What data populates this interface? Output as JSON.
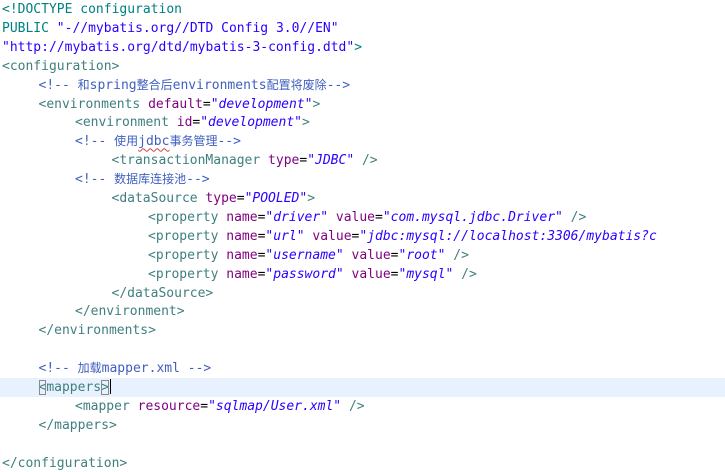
{
  "editor": {
    "lines": [
      {
        "indent": 0,
        "tokens": [
          {
            "t": "decl",
            "v": "<!DOCTYPE configuration"
          }
        ]
      },
      {
        "indent": 0,
        "tokens": [
          {
            "t": "decl",
            "v": "PUBLIC "
          },
          {
            "t": "value",
            "v": "\"-//mybatis.org//DTD Config 3.0//EN\""
          }
        ]
      },
      {
        "indent": 0,
        "tokens": [
          {
            "t": "value",
            "v": "\"http://mybatis.org/dtd/mybatis-3-config.dtd\""
          },
          {
            "t": "decl",
            "v": ">"
          }
        ]
      },
      {
        "indent": 0,
        "tokens": [
          {
            "t": "tag",
            "v": "<configuration>"
          }
        ]
      },
      {
        "indent": 1,
        "tokens": [
          {
            "t": "comment",
            "v": "<!-- "
          },
          {
            "t": "cjk",
            "v": "和"
          },
          {
            "t": "comment",
            "v": "spring"
          },
          {
            "t": "cjk",
            "v": "整合后"
          },
          {
            "t": "comment",
            "v": "environments"
          },
          {
            "t": "cjk",
            "v": "配置将废除"
          },
          {
            "t": "comment",
            "v": "-->"
          }
        ]
      },
      {
        "indent": 1,
        "tokens": [
          {
            "t": "tag",
            "v": "<environments "
          },
          {
            "t": "attr",
            "v": "default"
          },
          {
            "t": "plain",
            "v": "="
          },
          {
            "t": "ivalue",
            "v": "\"development\""
          },
          {
            "t": "tag",
            "v": ">"
          }
        ]
      },
      {
        "indent": 2,
        "tokens": [
          {
            "t": "tag",
            "v": "<environment "
          },
          {
            "t": "attr",
            "v": "id"
          },
          {
            "t": "plain",
            "v": "="
          },
          {
            "t": "ivalue",
            "v": "\"development\""
          },
          {
            "t": "tag",
            "v": ">"
          }
        ]
      },
      {
        "indent": 2,
        "tokens": [
          {
            "t": "comment",
            "v": "<!-- "
          },
          {
            "t": "cjk",
            "v": "使用"
          },
          {
            "t": "spell",
            "v": "jdbc"
          },
          {
            "t": "cjk",
            "v": "事务管理"
          },
          {
            "t": "comment",
            "v": "-->"
          }
        ]
      },
      {
        "indent": 3,
        "tokens": [
          {
            "t": "tag",
            "v": "<transactionManager "
          },
          {
            "t": "attr",
            "v": "type"
          },
          {
            "t": "plain",
            "v": "="
          },
          {
            "t": "ivalue",
            "v": "\"JDBC\""
          },
          {
            "t": "tag",
            "v": " />"
          }
        ]
      },
      {
        "indent": 2,
        "tokens": [
          {
            "t": "comment",
            "v": "<!-- "
          },
          {
            "t": "cjk",
            "v": "数据库连接池"
          },
          {
            "t": "comment",
            "v": "-->"
          }
        ]
      },
      {
        "indent": 3,
        "tokens": [
          {
            "t": "tag",
            "v": "<dataSource "
          },
          {
            "t": "attr",
            "v": "type"
          },
          {
            "t": "plain",
            "v": "="
          },
          {
            "t": "ivalue",
            "v": "\"POOLED\""
          },
          {
            "t": "tag",
            "v": ">"
          }
        ]
      },
      {
        "indent": 4,
        "tokens": [
          {
            "t": "tag",
            "v": "<property "
          },
          {
            "t": "attr",
            "v": "name"
          },
          {
            "t": "plain",
            "v": "="
          },
          {
            "t": "ivalue",
            "v": "\"driver\""
          },
          {
            "t": "plain",
            "v": " "
          },
          {
            "t": "attr",
            "v": "value"
          },
          {
            "t": "plain",
            "v": "="
          },
          {
            "t": "ivalue",
            "v": "\"com.mysql.jdbc.Driver\""
          },
          {
            "t": "tag",
            "v": " />"
          }
        ]
      },
      {
        "indent": 4,
        "tokens": [
          {
            "t": "tag",
            "v": "<property "
          },
          {
            "t": "attr",
            "v": "name"
          },
          {
            "t": "plain",
            "v": "="
          },
          {
            "t": "ivalue",
            "v": "\"url\""
          },
          {
            "t": "plain",
            "v": " "
          },
          {
            "t": "attr",
            "v": "value"
          },
          {
            "t": "plain",
            "v": "="
          },
          {
            "t": "ivalue",
            "v": "\"jdbc:mysql://localhost:3306/mybatis?c"
          }
        ]
      },
      {
        "indent": 4,
        "tokens": [
          {
            "t": "tag",
            "v": "<property "
          },
          {
            "t": "attr",
            "v": "name"
          },
          {
            "t": "plain",
            "v": "="
          },
          {
            "t": "ivalue",
            "v": "\"username\""
          },
          {
            "t": "plain",
            "v": " "
          },
          {
            "t": "attr",
            "v": "value"
          },
          {
            "t": "plain",
            "v": "="
          },
          {
            "t": "ivalue",
            "v": "\"root\""
          },
          {
            "t": "tag",
            "v": " />"
          }
        ]
      },
      {
        "indent": 4,
        "tokens": [
          {
            "t": "tag",
            "v": "<property "
          },
          {
            "t": "attr",
            "v": "name"
          },
          {
            "t": "plain",
            "v": "="
          },
          {
            "t": "ivalue",
            "v": "\"password\""
          },
          {
            "t": "plain",
            "v": " "
          },
          {
            "t": "attr",
            "v": "value"
          },
          {
            "t": "plain",
            "v": "="
          },
          {
            "t": "ivalue",
            "v": "\"mysql\""
          },
          {
            "t": "tag",
            "v": " />"
          }
        ]
      },
      {
        "indent": 3,
        "tokens": [
          {
            "t": "tag",
            "v": "</dataSource>"
          }
        ]
      },
      {
        "indent": 2,
        "tokens": [
          {
            "t": "tag",
            "v": "</environment>"
          }
        ]
      },
      {
        "indent": 1,
        "tokens": [
          {
            "t": "tag",
            "v": "</environments>"
          }
        ]
      },
      {
        "indent": 0,
        "tokens": []
      },
      {
        "indent": 1,
        "tokens": [
          {
            "t": "comment",
            "v": "<!-- "
          },
          {
            "t": "cjk",
            "v": "加载"
          },
          {
            "t": "comment",
            "v": "mapper.xml -->"
          }
        ]
      },
      {
        "indent": 1,
        "current": true,
        "tokens": [
          {
            "t": "tag",
            "v": "<",
            "match": true
          },
          {
            "t": "tag",
            "v": "mappers"
          },
          {
            "t": "tag",
            "v": ">",
            "match": true
          },
          {
            "t": "caret",
            "v": ""
          }
        ]
      },
      {
        "indent": 2,
        "tokens": [
          {
            "t": "tag",
            "v": "<mapper "
          },
          {
            "t": "attr",
            "v": "resource"
          },
          {
            "t": "plain",
            "v": "="
          },
          {
            "t": "ivalue",
            "v": "\"sqlmap/User.xml\""
          },
          {
            "t": "tag",
            "v": " />"
          }
        ]
      },
      {
        "indent": 1,
        "tokens": [
          {
            "t": "tag",
            "v": "</mappers>"
          }
        ]
      },
      {
        "indent": 0,
        "tokens": []
      },
      {
        "indent": 0,
        "tokens": [
          {
            "t": "tag",
            "v": "</configuration>"
          }
        ]
      }
    ]
  }
}
